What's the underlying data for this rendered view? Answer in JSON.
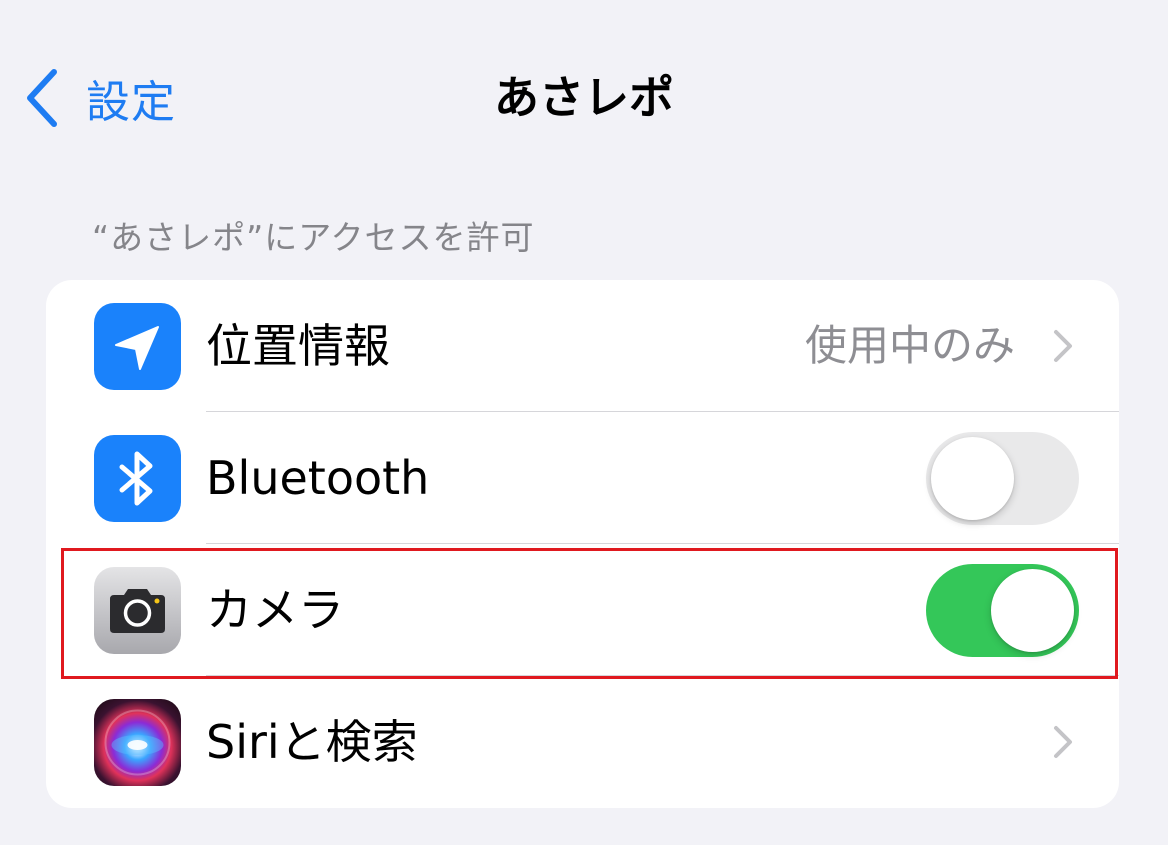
{
  "nav": {
    "back_label": "設定",
    "title": "あさレポ"
  },
  "section": {
    "header": "“あさレポ”にアクセスを許可"
  },
  "rows": [
    {
      "label": "位置情報",
      "value": "使用中のみ",
      "icon": "location-arrow-icon",
      "accessory": "chevron"
    },
    {
      "label": "Bluetooth",
      "icon": "bluetooth-icon",
      "accessory": "toggle",
      "toggle_on": false
    },
    {
      "label": "カメラ",
      "icon": "camera-icon",
      "accessory": "toggle",
      "toggle_on": true
    },
    {
      "label": "Siriと検索",
      "icon": "siri-icon",
      "accessory": "chevron"
    }
  ],
  "colors": {
    "accent": "#1e7cf2",
    "toggle_on": "#34c759",
    "toggle_off": "#e9e9ea",
    "highlight": "#e0191f",
    "background": "#f2f2f7"
  }
}
